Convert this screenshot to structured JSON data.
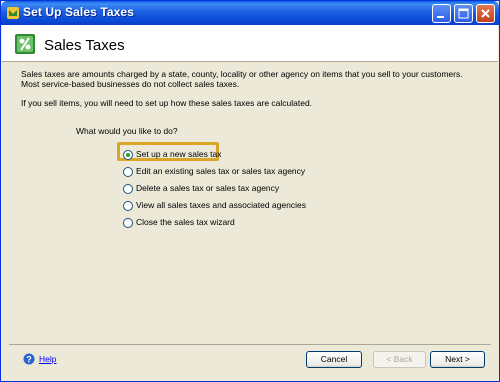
{
  "window": {
    "title": "Set Up Sales Taxes",
    "icon": "quickbooks-app-icon",
    "controls": [
      "minimize-icon",
      "maximize-icon",
      "close-icon"
    ]
  },
  "header": {
    "title": "Sales Taxes",
    "icon": "sales-tax-icon"
  },
  "intro": {
    "line1": "Sales taxes are amounts charged by a state, county, locality or other agency on items that you sell to your customers.",
    "line2": "Most service-based businesses do not collect sales taxes.",
    "line3": "If you sell items, you will need to set up how these sales taxes are calculated."
  },
  "question": "What would you like to do?",
  "options": [
    {
      "label": "Set up a new sales tax",
      "selected": true
    },
    {
      "label": "Edit an existing sales tax or sales tax agency",
      "selected": false
    },
    {
      "label": "Delete a sales tax or sales tax agency",
      "selected": false
    },
    {
      "label": "View all sales taxes and associated agencies",
      "selected": false
    },
    {
      "label": "Close the sales tax wizard",
      "selected": false
    }
  ],
  "footer": {
    "help_label": "Help",
    "cancel_label": "Cancel",
    "back_label": "< Back",
    "next_label": "Next >"
  },
  "colors": {
    "titlebar": "#0b4ad8",
    "highlight": "#d9a727",
    "radio_dot": "#21a121",
    "link": "#0000ff"
  }
}
